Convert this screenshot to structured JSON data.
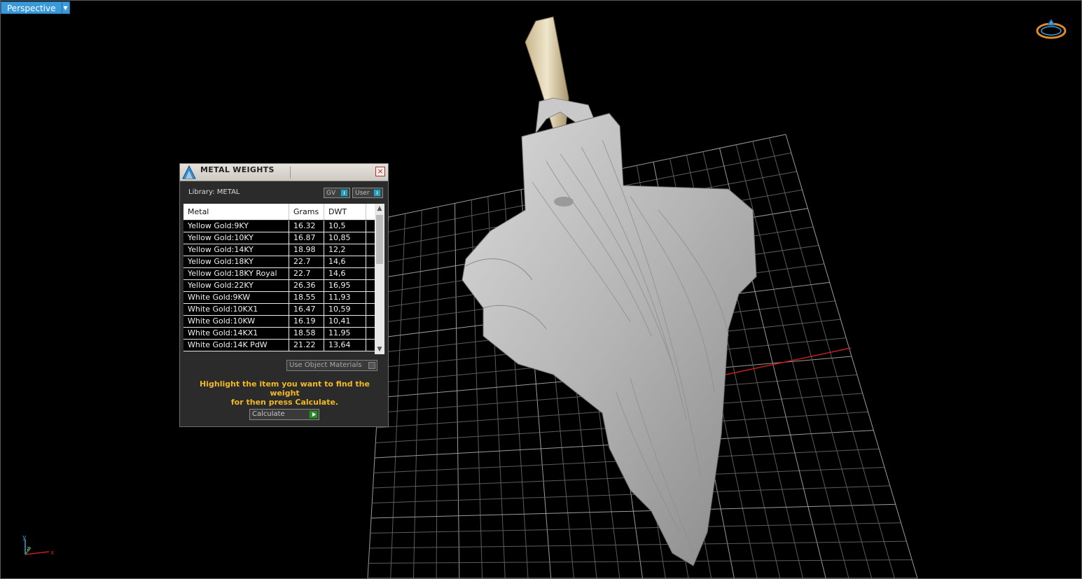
{
  "viewport": {
    "label": "Perspective"
  },
  "dialog": {
    "title": "METAL WEIGHTS",
    "library_label": "Library: METAL",
    "toggle_gv": "GV",
    "toggle_user": "User",
    "columns": [
      "Metal",
      "Grams",
      "DWT"
    ],
    "rows": [
      [
        "Yellow Gold:9KY",
        "16.32",
        "10,5"
      ],
      [
        "Yellow Gold:10KY",
        "16.87",
        "10,85"
      ],
      [
        "Yellow Gold:14KY",
        "18.98",
        "12,2"
      ],
      [
        "Yellow Gold:18KY",
        "22.7",
        "14,6"
      ],
      [
        "Yellow Gold:18KY Royal",
        "22.7",
        "14,6"
      ],
      [
        "Yellow Gold:22KY",
        "26.36",
        "16,95"
      ],
      [
        "White Gold:9KW",
        "18.55",
        "11,93"
      ],
      [
        "White Gold:10KX1",
        "16.47",
        "10,59"
      ],
      [
        "White Gold:10KW",
        "16.19",
        "10,41"
      ],
      [
        "White Gold:14KX1",
        "18.58",
        "11,95"
      ],
      [
        "White Gold:14K PdW",
        "21.22",
        "13,64"
      ]
    ],
    "use_object_materials": "Use Object Materials",
    "instruction_line1": "Highlight the item you want to find the weight",
    "instruction_line2": "for then press Calculate.",
    "calculate_label": "Calculate",
    "accent_color": "#f2b924"
  }
}
